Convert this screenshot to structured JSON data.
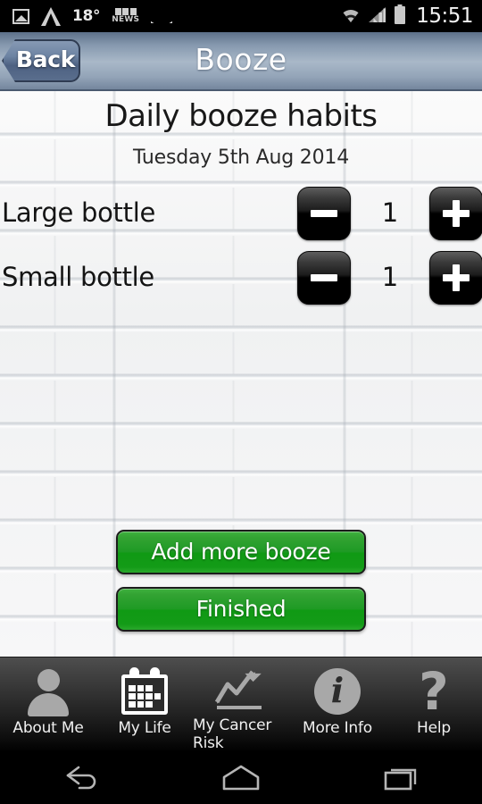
{
  "statusbar": {
    "temperature": "18°",
    "bbc_label": "NEWS",
    "time": "15:51",
    "icons": [
      "photo-icon",
      "triangle-app-icon",
      "bbc-news-icon",
      "envelope-icon",
      "wifi-icon",
      "cellular-signal-icon",
      "battery-icon"
    ]
  },
  "titlebar": {
    "back_label": "Back",
    "title": "Booze"
  },
  "content": {
    "heading": "Daily booze habits",
    "date": "Tuesday 5th Aug 2014",
    "rows": [
      {
        "label": "Large bottle",
        "value": "1",
        "minus": "−",
        "plus": "+"
      },
      {
        "label": "Small bottle",
        "value": "1",
        "minus": "−",
        "plus": "+"
      }
    ],
    "buttons": {
      "add_more": "Add more booze",
      "finished": "Finished"
    }
  },
  "tabbar": {
    "items": [
      {
        "label": "About Me",
        "icon": "person-icon",
        "active": false
      },
      {
        "label": "My Life",
        "icon": "calendar-icon",
        "active": true
      },
      {
        "label": "My Cancer Risk",
        "icon": "trend-chart-icon",
        "active": false
      },
      {
        "label": "More Info",
        "icon": "info-circle-icon",
        "active": false
      },
      {
        "label": "Help",
        "icon": "question-mark-icon",
        "active": false
      }
    ]
  },
  "navbar": {
    "buttons": [
      "back-nav-icon",
      "home-nav-icon",
      "recent-apps-nav-icon"
    ]
  },
  "colors": {
    "accent_green": "#1e9a24",
    "titlebar_blue": "#8598ae",
    "tabbar_dark": "#3b3b3b",
    "status_black": "#000000"
  }
}
